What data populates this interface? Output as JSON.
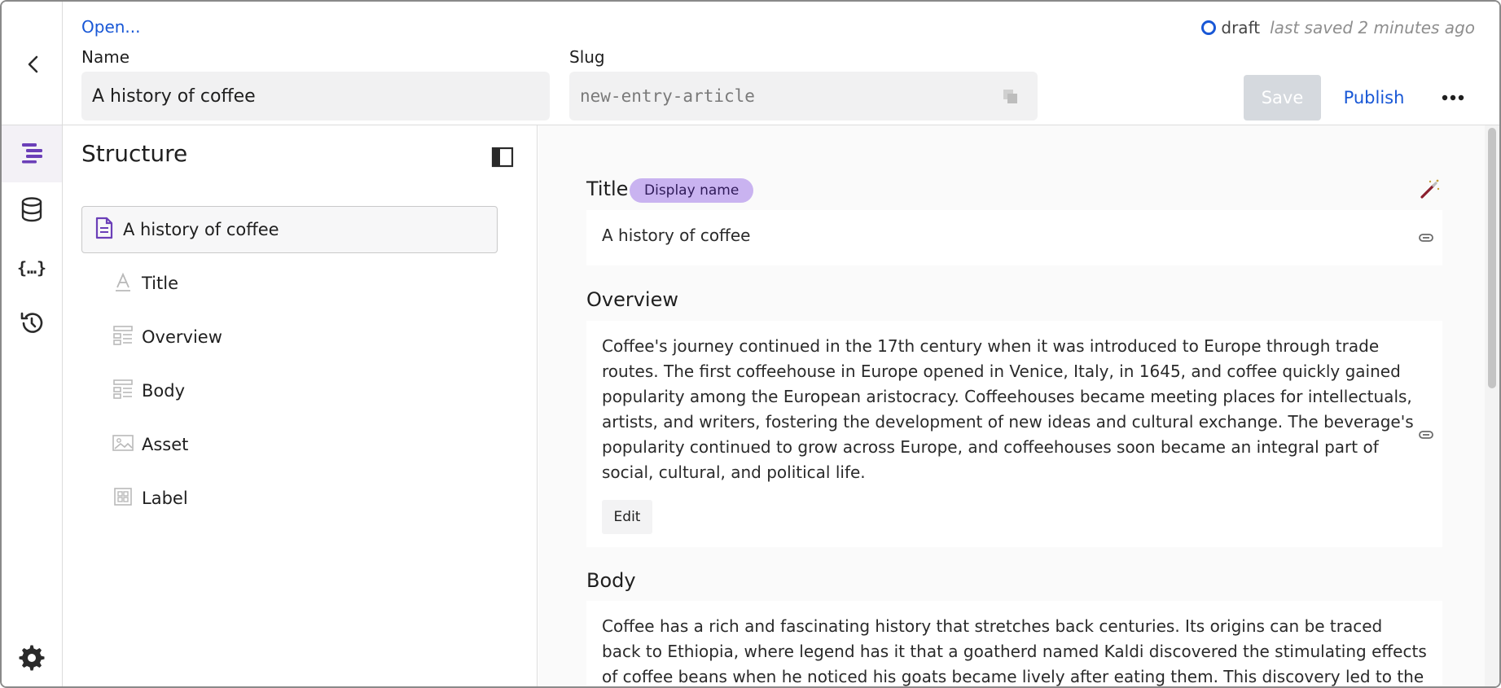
{
  "header": {
    "open_link": "Open...",
    "name_label": "Name",
    "name_value": "A history of coffee",
    "slug_label": "Slug",
    "slug_value": "new-entry-article",
    "status": "draft",
    "last_saved": "last saved 2 minutes ago",
    "save_label": "Save",
    "publish_label": "Publish"
  },
  "structure": {
    "title": "Structure",
    "root_label": "A history of coffee",
    "items": [
      {
        "label": "Title",
        "icon": "text-field-icon"
      },
      {
        "label": "Overview",
        "icon": "rich-text-icon"
      },
      {
        "label": "Body",
        "icon": "rich-text-icon"
      },
      {
        "label": "Asset",
        "icon": "image-icon"
      },
      {
        "label": "Label",
        "icon": "grid-icon"
      }
    ]
  },
  "editor": {
    "title_field": {
      "label": "Title",
      "badge": "Display name",
      "value": "A history of coffee"
    },
    "overview_field": {
      "label": "Overview",
      "lines": [
        "Coffee's journey continued in the 17th century when it was introduced to Europe through trade",
        "routes. The first coffeehouse in Europe opened in Venice, Italy, in 1645, and coffee quickly gained",
        "popularity among the European aristocracy. Coffeehouses became meeting places for intellectuals,",
        "artists, and writers, fostering the development of new ideas and cultural exchange. The beverage's",
        "popularity continued to grow across Europe, and coffeehouses soon became an integral part of",
        "social, cultural, and political life."
      ],
      "edit_label": "Edit"
    },
    "body_field": {
      "label": "Body",
      "lines": [
        "Coffee has a rich and fascinating history that stretches back centuries. Its origins can be traced",
        "back to Ethiopia, where legend has it that a goatherd named Kaldi discovered the stimulating effects",
        "of coffee beans when he noticed his goats became lively after eating them. This discovery led to the"
      ]
    }
  },
  "colors": {
    "accent": "#1857d6",
    "brand_purple": "#6b3fb8",
    "badge_bg": "#c9b3f0",
    "save_disabled": "#d5d9de"
  },
  "icons": [
    "back-chevron-icon",
    "copy-icon",
    "more-icon",
    "structure-icon",
    "database-icon",
    "braces-icon",
    "history-icon",
    "settings-icon",
    "panel-toggle-icon",
    "document-icon",
    "wand-icon",
    "link-icon"
  ]
}
